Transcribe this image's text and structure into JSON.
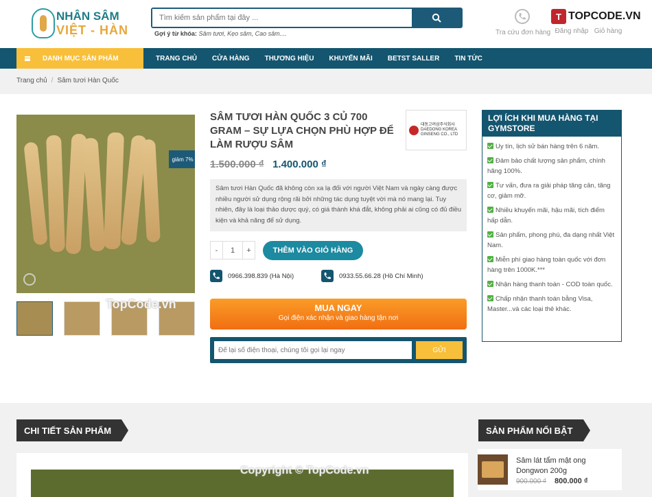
{
  "header": {
    "logo_line1": "NHÂN SÂM",
    "logo_line2": "VIỆT - HÀN",
    "search_placeholder": "Tìm kiếm sản phẩm tại đây ...",
    "suggest_label": "Gợi ý từ khóa:",
    "suggest_keywords": "Sâm tươi, Kẹo sâm, Cao sâm....",
    "icons": [
      {
        "label": "Tra cứu đơn hàng",
        "icon": "phone-icon"
      },
      {
        "label": "Đăng nhập",
        "icon": "user-icon"
      },
      {
        "label": "Giỏ hàng",
        "icon": "cart-icon"
      }
    ],
    "watermark_brand": "TOPCODE.VN"
  },
  "nav": {
    "category_label": "DANH MỤC SẢN PHẨM",
    "items": [
      "TRANG CHỦ",
      "CỬA HÀNG",
      "THƯƠNG HIỆU",
      "KHUYẾN MÃI",
      "BETST SALLER",
      "TIN TỨC"
    ]
  },
  "breadcrumb": {
    "home": "Trang chủ",
    "current": "Sâm tươi Hàn Quốc"
  },
  "product": {
    "badge": "giảm 7%",
    "title": "SÂM TƯƠI HÀN QUỐC 3 CỦ 700 GRAM – SỰ LỰA CHỌN PHÙ HỢP ĐỂ LÀM RƯỢU SÂM",
    "brand_logo_text": "대동고려삼주식회사 DAEDONG KOREA GINSENG CO., LTD",
    "old_price": "1.500.000 ₫",
    "new_price": "1.400.000 ₫",
    "description": "Sâm tươi Hàn Quốc đã không còn xa lạ đối với người Việt Nam và ngày càng được nhiều người sử dụng rộng rãi bởi những tác dụng tuyệt vời mà nó mang lại. Tuy nhiên, đây là loại thảo dược quý, có giá thành khá đắt, không phải ai cũng có đủ điều kiện và khả năng để sử dụng.",
    "qty_minus": "-",
    "qty_value": "1",
    "qty_plus": "+",
    "add_to_cart": "THÊM VÀO GIỎ HÀNG",
    "phone1": "0966.398.839 (Hà Nội)",
    "phone2": "0933.55.66.28 (Hồ Chí Minh)",
    "buy_now": "MUA NGAY",
    "buy_now_sub": "Gọi điện xác nhận và giao hàng tận nơi",
    "callback_placeholder": "Để lại số điện thoại, chúng tôi gọi lại ngay",
    "callback_send": "GỬI",
    "watermark": "TopCode.vn"
  },
  "benefits": {
    "title": "LỢI ÍCH KHI MUA HÀNG TẠI GYMSTORE",
    "items": [
      "Uy tín, lịch sử bán hàng trên 6 năm.",
      "Đảm bảo chất lượng sản phẩm, chính hãng 100%.",
      "Tư vấn, đưa ra giải pháp tăng cân, tăng cơ, giảm mỡ.",
      "Nhiều khuyến mãi, hậu mãi, tích điểm hấp dẫn.",
      "Sản phẩm, phong phú, đa dạng nhất Việt Nam.",
      "Miễn phí giao hàng toàn quốc với đơn hàng trên 1000K.***",
      "Nhận hàng thanh toán - COD toàn quốc.",
      "Chấp nhận thanh toán bằng Visa, Master...và các loại thẻ khác."
    ]
  },
  "section": {
    "detail_title": "CHI TIẾT SẢN PHẨM",
    "featured_title": "SẢN PHẨM NỔI BẬT",
    "featured_item": {
      "name": "Sâm lát tẩm mật ong Dongwon 200g",
      "old_price": "900.000 ₫",
      "new_price": "800.000 ₫"
    },
    "watermark": "Copyright © TopCode.vn"
  },
  "colors": {
    "primary": "#14556f",
    "accent": "#f8bf3a",
    "buy": "#f27a16",
    "cart": "#1c8aa0"
  }
}
